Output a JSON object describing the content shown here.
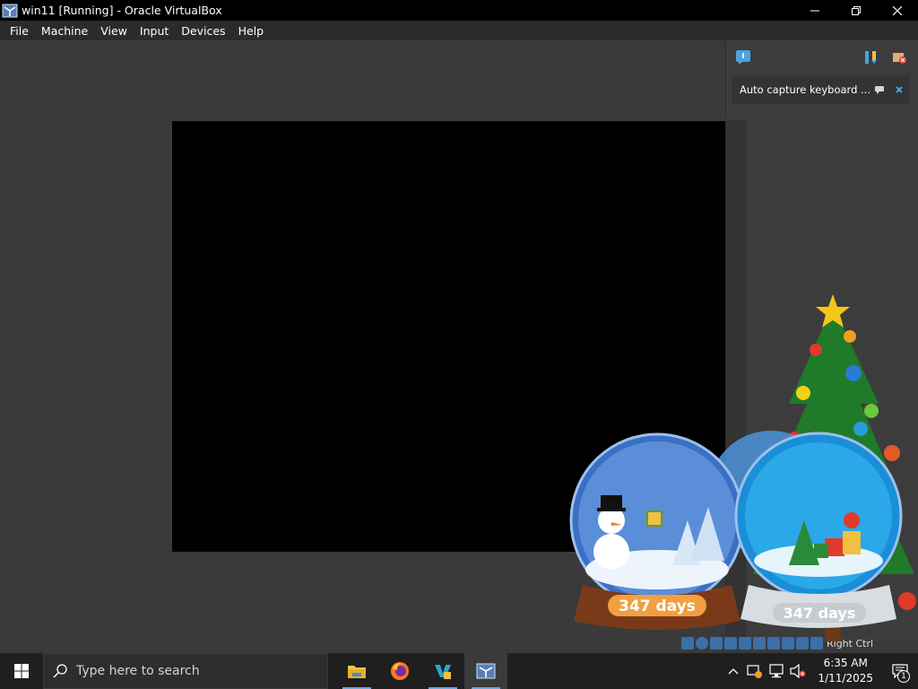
{
  "window": {
    "title": "win11 [Running] - Oracle VirtualBox",
    "icon": "virtualbox-icon"
  },
  "menu": [
    "File",
    "Machine",
    "View",
    "Input",
    "Devices",
    "Help"
  ],
  "notification_panel": {
    "message": "Auto capture keyboard ...",
    "toggle_icon": "notification-center-icon",
    "sort_icon": "sort-icon",
    "clear_icon": "clear-all-icon"
  },
  "statusbar": {
    "host_key": "Right Ctrl"
  },
  "decoration": {
    "countdown_left": "347 days",
    "countdown_right": "347 days"
  },
  "taskbar": {
    "search_placeholder": "Type here to search",
    "apps": [
      "file-explorer-icon",
      "firefox-icon",
      "vs-icon",
      "virtualbox-icon"
    ],
    "clock_time": "6:35 AM",
    "clock_date": "1/11/2025",
    "notification_count": "1"
  }
}
